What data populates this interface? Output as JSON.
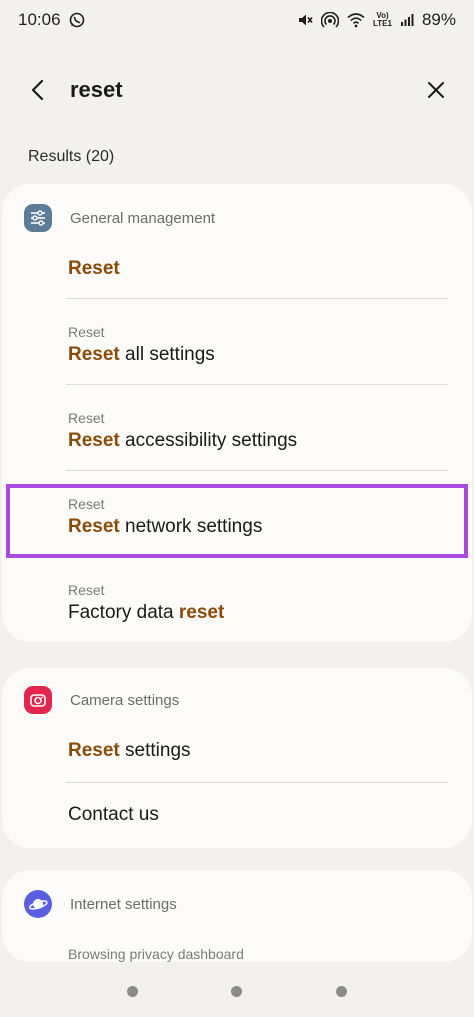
{
  "status_bar": {
    "time": "10:06",
    "lte_line1": "Vo)",
    "lte_line2": "LTE1",
    "battery": "89%"
  },
  "search": {
    "query": "reset"
  },
  "results_label": "Results (20)",
  "groups": [
    {
      "title": "General management",
      "icon": "sliders-icon",
      "icon_color": "#5d7d96",
      "items": [
        {
          "crumb": "",
          "highlight": "Reset",
          "rest": ""
        },
        {
          "crumb": "Reset",
          "highlight": "Reset",
          "rest": " all settings"
        },
        {
          "crumb": "Reset",
          "highlight": "Reset",
          "rest": " accessibility settings"
        },
        {
          "crumb": "Reset",
          "highlight": "Reset",
          "rest": " network settings"
        },
        {
          "crumb": "Reset",
          "prefix": "Factory data ",
          "highlight": "reset",
          "rest": ""
        }
      ]
    },
    {
      "title": "Camera settings",
      "icon": "camera-icon",
      "icon_color": "#e2264d",
      "items": [
        {
          "crumb": "",
          "highlight": "Reset",
          "rest": " settings"
        },
        {
          "crumb": "",
          "prefix": "Contact us",
          "highlight": "",
          "rest": ""
        }
      ]
    },
    {
      "title": "Internet settings",
      "icon": "planet-icon",
      "icon_color": "#5a5fe0",
      "items": [
        {
          "crumb": "Browsing privacy dashboard"
        }
      ]
    }
  ],
  "colors": {
    "highlight_text": "#8a4a08",
    "annotation_box": "#a94be0",
    "background": "#f3f1ee",
    "card": "#fcfbfa"
  }
}
